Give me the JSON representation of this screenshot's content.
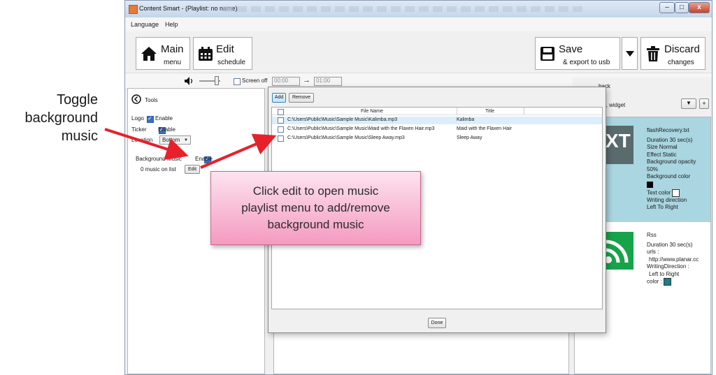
{
  "callouts": {
    "toggle_line1": "Toggle",
    "toggle_line2": "background",
    "toggle_line3": "music",
    "edit_note_line1": "Click edit to open music",
    "edit_note_line2": "playlist menu to add/remove",
    "edit_note_line3": "background music"
  },
  "window": {
    "title": "Content Smart - (Playlist: no name)",
    "controls": {
      "minimize": "–",
      "maximize": "□",
      "close": "x"
    }
  },
  "menu": {
    "items": [
      "Language",
      "Help"
    ]
  },
  "toolbar": {
    "main": {
      "label": "Main",
      "sub": "menu"
    },
    "edit": {
      "label": "Edit",
      "sub": "schedule"
    },
    "save": {
      "label": "Save",
      "sub": "& export to usb"
    },
    "discard": {
      "label": "Discard",
      "sub": "changes"
    }
  },
  "controls_strip": {
    "screen_off_label": "Screen off",
    "time_start": "00:00",
    "time_end": "01:00"
  },
  "tools": {
    "title": "Tools",
    "logo_label": "Logo",
    "enable_label": "Enable",
    "ticker_label": "Ticker",
    "location_label": "Location",
    "location_value": "Bottom",
    "bg_music_label": "Background Music",
    "music_count": "0  music on list",
    "edit_button": "Edit"
  },
  "dialog": {
    "add_button": "Add",
    "remove_button": "Remove",
    "columns": [
      "File Name",
      "Title"
    ],
    "rows": [
      {
        "file": "C:\\Users\\Public\\Music\\Sample Music\\Kalimba.mp3",
        "title": "Kalimba"
      },
      {
        "file": "C:\\Users\\Public\\Music\\Sample Music\\Maid with the Flaxen Hair.mp3",
        "title": "Maid with the Flaxen Hair"
      },
      {
        "file": "C:\\Users\\Public\\Music\\Sample Music\\Sleep Away.mp3",
        "title": "Sleep Away"
      }
    ],
    "done_button": "Done"
  },
  "right_panel": {
    "back_text": "back",
    "widget_header": "ker, widget",
    "plus_button": "+",
    "widget1": {
      "thumb_text": "XT",
      "name": "flashRecovery.txt",
      "duration": "Duration   30  sec(s)",
      "size": "Size   Normal",
      "effect": "Effect   Static",
      "bg_opacity_label": "Background opacity",
      "bg_opacity_value": "50%",
      "bg_color_label": "Background color",
      "text_color_label": "Text color",
      "writing_direction_label": "Writing direction",
      "writing_direction_value": "Left To Right"
    },
    "widget2": {
      "name": "Rss",
      "duration": "Duration   30  sec(s)",
      "urls_label": "urls :",
      "url": "http://www.planar.cc",
      "writing_direction_label": "WritingDirection :",
      "writing_direction_value": "Left to Right",
      "color_label": "color :"
    }
  },
  "colors": {
    "arrow": "#e8202a",
    "widget_bg": "#a9d6e0",
    "rss_green": "#17a34a",
    "teal_swatch": "#1b7e86",
    "selection": "#dceefb"
  }
}
